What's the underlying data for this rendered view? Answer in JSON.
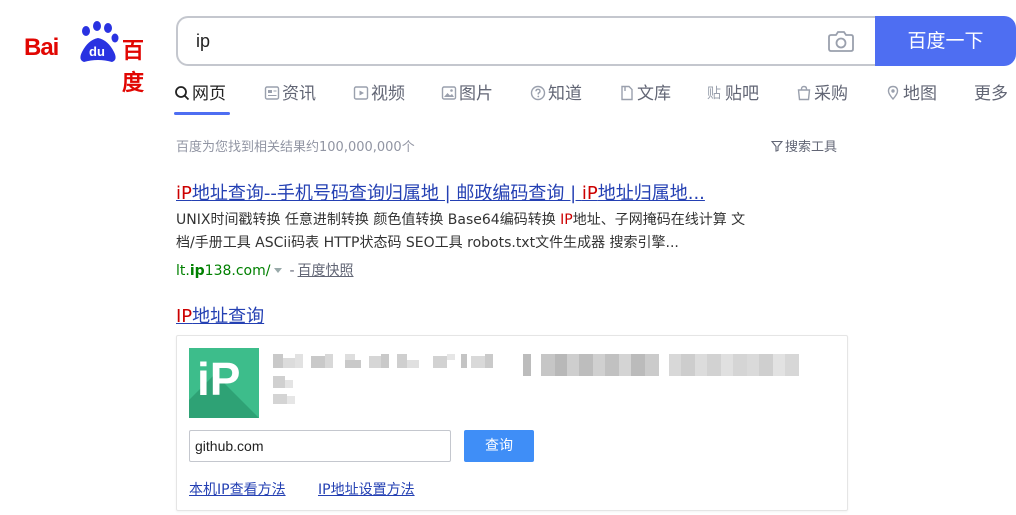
{
  "logo": {
    "bai": "Bai",
    "du": "du",
    "cn": "百度"
  },
  "search": {
    "query": "ip",
    "button_label": "百度一下"
  },
  "tabs": [
    {
      "label": "网页",
      "icon": "search-icon",
      "active": true
    },
    {
      "label": "资讯",
      "icon": "news-icon"
    },
    {
      "label": "视频",
      "icon": "video-icon"
    },
    {
      "label": "图片",
      "icon": "image-icon"
    },
    {
      "label": "知道",
      "icon": "question-icon"
    },
    {
      "label": "文库",
      "icon": "document-icon"
    },
    {
      "label": "贴吧",
      "icon": "tieba-icon"
    },
    {
      "label": "采购",
      "icon": "shopping-icon"
    },
    {
      "label": "地图",
      "icon": "map-icon"
    },
    {
      "label": "更多"
    }
  ],
  "results_info": {
    "count_text": "百度为您找到相关结果约100,000,000个",
    "tools_label": "搜索工具"
  },
  "result1": {
    "title_parts": [
      "iP",
      "地址查询--手机号码查询归属地 | 邮政编码查询 | ",
      "iP",
      "地址归属地..."
    ],
    "abstract_line1_a": "UNIX时间戳转换 任意进制转换 颜色值转换 Base64编码转换 ",
    "abstract_hl": "IP",
    "abstract_line1_b": "地址、子网掩码在线计算 文",
    "abstract_line2": "档/手册工具 ASCii码表 HTTP状态码 SEO工具 robots.txt文件生成器 搜索引擎...",
    "url_a": "lt.",
    "url_b": "ip",
    "url_c": "138.com/",
    "snapshot": "百度快照"
  },
  "result2": {
    "title_hl": "IP",
    "title_rest": "地址查询",
    "logo_text": "iP",
    "input_value": "github.com",
    "button_label": "查询",
    "link1": "本机IP查看方法",
    "link2": "IP地址设置方法"
  },
  "colors": {
    "accent": "#4e6ef2",
    "brand_red": "#e10602",
    "link": "#2440b3",
    "highlight": "#c00",
    "url_green": "#008000",
    "ip_green": "#3dbd8b"
  }
}
